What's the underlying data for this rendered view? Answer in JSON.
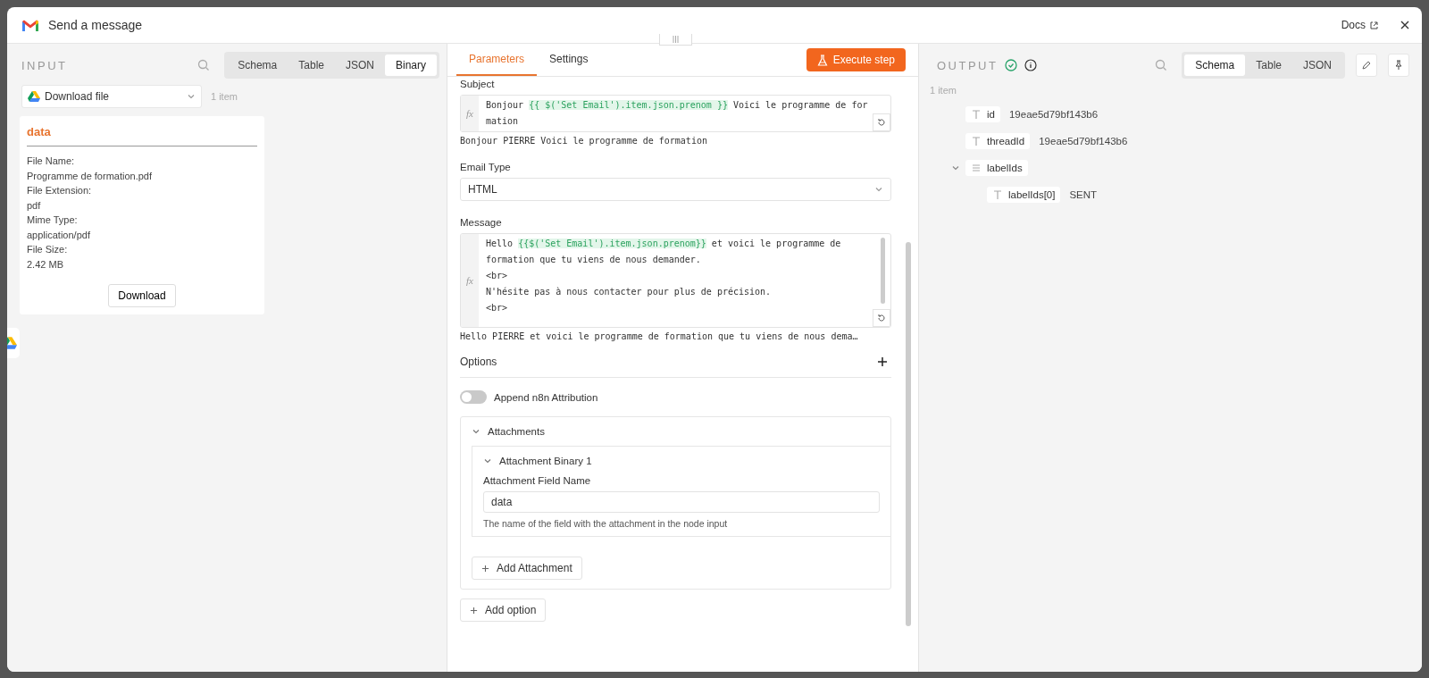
{
  "window": {
    "title": "Send a message",
    "docs_link": "Docs"
  },
  "input": {
    "heading": "INPUT",
    "view_tabs": [
      {
        "label": "Schema",
        "selected": false
      },
      {
        "label": "Table",
        "selected": false
      },
      {
        "label": "JSON",
        "selected": false
      },
      {
        "label": "Binary",
        "selected": true
      }
    ],
    "source": {
      "value": "Download file",
      "count": "1 item"
    },
    "binary": {
      "title": "data",
      "fields": [
        {
          "label": "File Name:",
          "value": "Programme de formation.pdf"
        },
        {
          "label": "File Extension:",
          "value": "pdf"
        },
        {
          "label": "Mime Type:",
          "value": "application/pdf"
        },
        {
          "label": "File Size:",
          "value": "2.42 MB"
        }
      ],
      "button": "Download"
    }
  },
  "parameters": {
    "tabs": [
      {
        "label": "Parameters",
        "selected": true
      },
      {
        "label": "Settings",
        "selected": false
      }
    ],
    "execute_button": "Execute step",
    "subject": {
      "label": "Subject",
      "fx_label": "fx",
      "parts": [
        {
          "text": "Bonjour ",
          "kind": "plain"
        },
        {
          "text": "{{ $('Set Email').item.json.prenom }}",
          "kind": "expr"
        },
        {
          "text": " Voici le programme de formation",
          "kind": "plain"
        }
      ],
      "preview": "Bonjour PIERRE Voici le programme de formation"
    },
    "email_type": {
      "label": "Email Type",
      "value": "HTML"
    },
    "message": {
      "label": "Message",
      "fx_label": "fx",
      "lines": [
        [
          {
            "text": "Hello ",
            "kind": "plain"
          },
          {
            "text": "{{$('Set Email').item.json.prenom}}",
            "kind": "expr"
          },
          {
            "text": " et voici le programme de formation que tu viens de nous demander.",
            "kind": "plain"
          }
        ],
        [
          {
            "text": "<br>",
            "kind": "plain"
          }
        ],
        [
          {
            "text": "N'hésite pas à nous contacter pour plus de précision.",
            "kind": "plain"
          }
        ],
        [
          {
            "text": "<br>",
            "kind": "plain"
          }
        ]
      ],
      "preview": "Hello PIERRE et voici le programme de formation que tu viens de nous dema…"
    },
    "options_label": "Options",
    "attribution": {
      "label": "Append n8n Attribution",
      "on": false
    },
    "attachments": {
      "label": "Attachments",
      "expanded": true,
      "items": [
        {
          "title": "Attachment Binary 1",
          "expanded": true,
          "field_label": "Attachment Field Name",
          "value": "data",
          "hint": "The name of the field with the attachment in the node input"
        }
      ],
      "add_button": "Add Attachment"
    },
    "add_option": "Add option"
  },
  "output": {
    "heading": "OUTPUT",
    "count": "1 item",
    "view_tabs": [
      {
        "label": "Schema",
        "selected": true
      },
      {
        "label": "Table",
        "selected": false
      },
      {
        "label": "JSON",
        "selected": false
      }
    ],
    "schema": [
      {
        "key": "id",
        "kind": "string",
        "value": "19eae5d79bf143b6"
      },
      {
        "key": "threadId",
        "kind": "string",
        "value": "19eae5d79bf143b6"
      },
      {
        "key": "labelIds",
        "kind": "array",
        "expanded": true,
        "children": [
          {
            "key": "labelIds[0]",
            "kind": "string",
            "value": "SENT"
          }
        ]
      }
    ]
  }
}
